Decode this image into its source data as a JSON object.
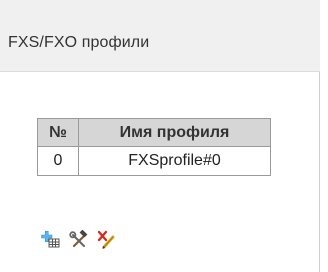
{
  "header": {
    "title": "FXS/FXO профили"
  },
  "table": {
    "columns": [
      "№",
      "Имя профиля"
    ],
    "rows": [
      {
        "num": "0",
        "name": "FXSprofile#0"
      }
    ]
  },
  "actions": [
    {
      "icon": "add-table-icon"
    },
    {
      "icon": "tools-icon"
    },
    {
      "icon": "delete-icon"
    }
  ]
}
